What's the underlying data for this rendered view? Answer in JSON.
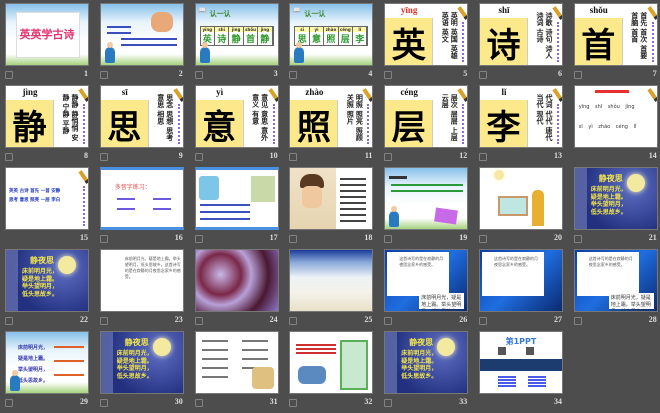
{
  "poem_title": "静夜思",
  "poem_lines": [
    "床前明月光，",
    "疑是地上霜。",
    "举头望明月，",
    "低头思故乡。"
  ],
  "slides": [
    {
      "n": "1",
      "kind": "title",
      "title": "英英学古诗"
    },
    {
      "n": "2",
      "kind": "sky-story"
    },
    {
      "n": "3",
      "kind": "recognize",
      "heading": "认一认",
      "chars": [
        [
          "yīng",
          "英"
        ],
        [
          "shī",
          "诗"
        ],
        [
          "jìng",
          "静"
        ],
        [
          "shǒu",
          "首"
        ],
        [
          "jìng",
          "静"
        ]
      ]
    },
    {
      "n": "4",
      "kind": "recognize",
      "heading": "认一认",
      "chars": [
        [
          "sī",
          "思"
        ],
        [
          "yì",
          "意"
        ],
        [
          "zhào",
          "照"
        ],
        [
          "céng",
          "层"
        ],
        [
          "lǐ",
          "李"
        ]
      ]
    },
    {
      "n": "5",
      "kind": "char",
      "pinyin": "yīng",
      "char": "英",
      "words": "英明 英国 英雄 英语 英文"
    },
    {
      "n": "6",
      "kind": "char",
      "pinyin": "shī",
      "char": "诗",
      "words": "诗歌 诗句 诗人 诗词 古诗"
    },
    {
      "n": "7",
      "kind": "char",
      "pinyin": "shǒu",
      "char": "首",
      "words": "首先 首次 首要 首脑 首首"
    },
    {
      "n": "8",
      "kind": "char",
      "pinyin": "jìng",
      "char": "静",
      "words": "静静 静悄悄 安静 宁静 平静"
    },
    {
      "n": "9",
      "kind": "char",
      "pinyin": "sī",
      "char": "思",
      "words": "思念 思想 思考 意思 相思"
    },
    {
      "n": "10",
      "kind": "char",
      "pinyin": "yì",
      "char": "意",
      "words": "意见 意思 意外 意义 有意"
    },
    {
      "n": "11",
      "kind": "char",
      "pinyin": "zhào",
      "char": "照",
      "words": "明照 照亮 照顾 关照 照片"
    },
    {
      "n": "12",
      "kind": "char",
      "pinyin": "céng",
      "char": "层",
      "words": "层次 层层 上层 云层"
    },
    {
      "n": "13",
      "kind": "char",
      "pinyin": "lǐ",
      "char": "李",
      "words": "代词 代代 唐代 当代 现代"
    },
    {
      "n": "14",
      "kind": "pinyin-review",
      "rows": [
        "yīng shī shǒu jìng",
        "sī yì zhào céng lǐ"
      ]
    },
    {
      "n": "15",
      "kind": "words-review",
      "rows": [
        "英英 古诗 首先 一首 安静",
        "思考 意思 照亮 一层 李白"
      ]
    },
    {
      "n": "16",
      "kind": "exercise",
      "heading": "多音字练习："
    },
    {
      "n": "17",
      "kind": "exercise2"
    },
    {
      "n": "18",
      "kind": "portrait"
    },
    {
      "n": "19",
      "kind": "sky-quiz"
    },
    {
      "n": "20",
      "kind": "illustration"
    },
    {
      "n": "21",
      "kind": "blue-poem"
    },
    {
      "n": "22",
      "kind": "blue-poem"
    },
    {
      "n": "23",
      "kind": "doc"
    },
    {
      "n": "24",
      "kind": "frost"
    },
    {
      "n": "25",
      "kind": "field"
    },
    {
      "n": "26",
      "kind": "blue-doc",
      "panel": true
    },
    {
      "n": "27",
      "kind": "blue-doc",
      "panel": false
    },
    {
      "n": "28",
      "kind": "blue-doc",
      "panel": true
    },
    {
      "n": "29",
      "kind": "sky-lines"
    },
    {
      "n": "30",
      "kind": "blue-poem"
    },
    {
      "n": "31",
      "kind": "book"
    },
    {
      "n": "32",
      "kind": "cartoon"
    },
    {
      "n": "33",
      "kind": "blue-poem"
    },
    {
      "n": "34",
      "kind": "brand",
      "brand": "第1PPT"
    }
  ]
}
